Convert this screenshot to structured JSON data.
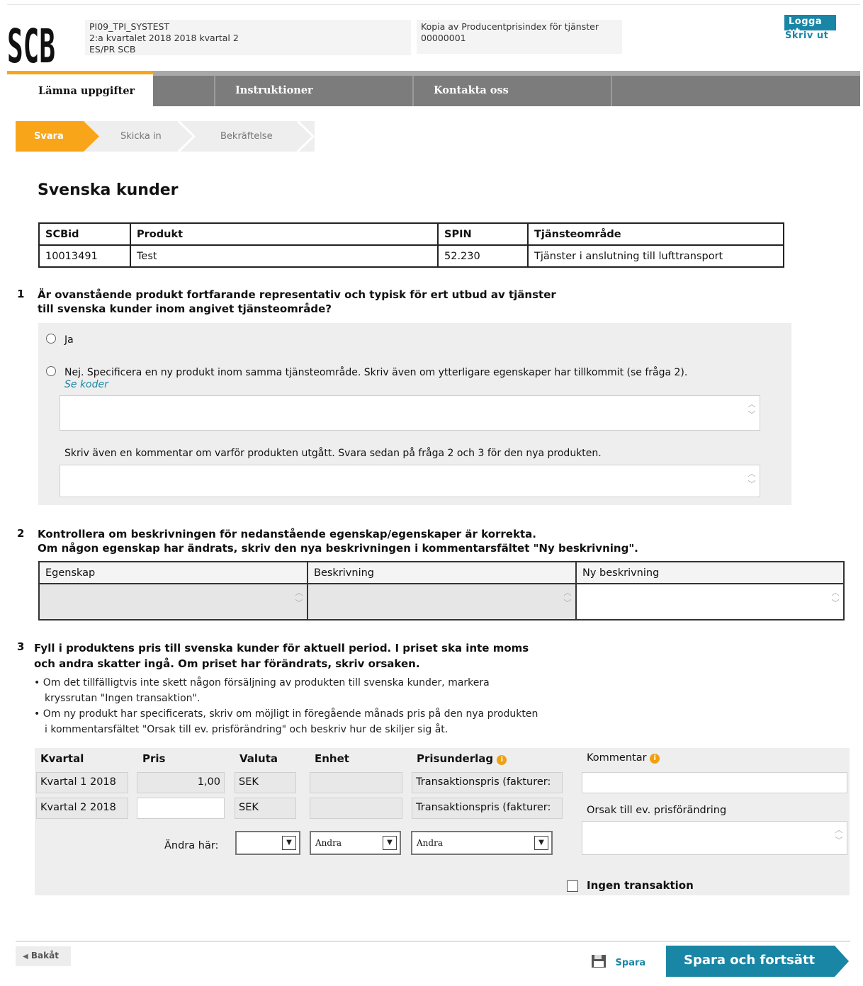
{
  "header": {
    "logo_text": "SCB",
    "info_left": [
      "PI09_TPI_SYSTEST",
      "2:a kvartalet 2018 2018 kvartal 2",
      "ES/PR SCB"
    ],
    "info_right": [
      "Kopia av Producentprisindex för tjänster",
      "00000001"
    ],
    "logout": "Logga ut",
    "print": "Skriv ut"
  },
  "nav": {
    "tabs": [
      "Lämna uppgifter",
      "Instruktioner",
      "Kontakta oss"
    ]
  },
  "steps": [
    "Svara",
    "Skicka in",
    "Bekräftelse"
  ],
  "page_title": "Svenska kunder",
  "product_table": {
    "headers": [
      "SCBid",
      "Produkt",
      "SPIN",
      "Tjänsteområde"
    ],
    "row": [
      "10013491",
      "Test",
      "52.230",
      "Tjänster i anslutning till lufttransport"
    ]
  },
  "q1": {
    "num": "1",
    "text_line1": "Är ovanstående produkt fortfarande representativ och typisk för ert utbud av tjänster",
    "text_line2": "till svenska kunder inom angivet tjänsteområde?",
    "opt_yes": "Ja",
    "opt_no": "Nej. Specificera en ny produkt inom samma tjänsteområde. Skriv även om ytterligare egenskaper har tillkommit (se fråga 2).",
    "see_codes": "Se koder",
    "comment_label": "Skriv även en kommentar om varför produkten utgått. Svara sedan på fråga 2 och 3 för den nya produkten."
  },
  "q2": {
    "num": "2",
    "text_line1": "Kontrollera om beskrivningen för nedanstående egenskap/egenskaper är korrekta.",
    "text_line2": "Om någon egenskap har ändrats, skriv den nya beskrivningen i kommentarsfältet \"Ny beskrivning\".",
    "headers": [
      "Egenskap",
      "Beskrivning",
      "Ny beskrivning"
    ]
  },
  "q3": {
    "num": "3",
    "text_line1": "Fyll i produktens pris till svenska kunder för aktuell period. I priset ska inte moms",
    "text_line2": "och andra skatter ingå. Om priset har förändrats, skriv orsaken.",
    "bullet1_line1": "• Om det tillfälligtvis inte skett någon försäljning av produkten till svenska kunder, markera",
    "bullet1_line2": "kryssrutan \"Ingen transaktion\".",
    "bullet2_line1": "• Om ny produkt har specificerats, skriv om möjligt in föregående månads pris på den nya produkten",
    "bullet2_line2": "i kommentarsfältet \"Orsak till ev. prisförändring\" och beskriv hur de skiljer sig åt."
  },
  "price_table": {
    "headers": [
      "Kvartal",
      "Pris",
      "Valuta",
      "Enhet",
      "Prisunderlag",
      "Kommentar"
    ],
    "rows": [
      {
        "kvartal": "Kvartal 1 2018",
        "pris": "1,00",
        "valuta": "SEK",
        "enhet": "",
        "prisunderlag": "Transaktionspris (fakturer:"
      },
      {
        "kvartal": "Kvartal 2 2018",
        "pris": "",
        "valuta": "SEK",
        "enhet": "",
        "prisunderlag": "Transaktionspris (fakturer:"
      }
    ],
    "change_label": "Ändra här:",
    "select_valuta": "",
    "select_enhet": "Andra",
    "select_prisunderlag": "Andra",
    "orsak_label": "Orsak till ev. prisförändring",
    "no_transaction": "Ingen transaktion"
  },
  "footer": {
    "back": "Bakåt",
    "save": "Spara",
    "save_continue": "Spara och fortsätt"
  },
  "colors": {
    "accent_orange": "#f9a51a",
    "accent_teal": "#1a86a6",
    "nav_gray": "#7c7c7c"
  }
}
